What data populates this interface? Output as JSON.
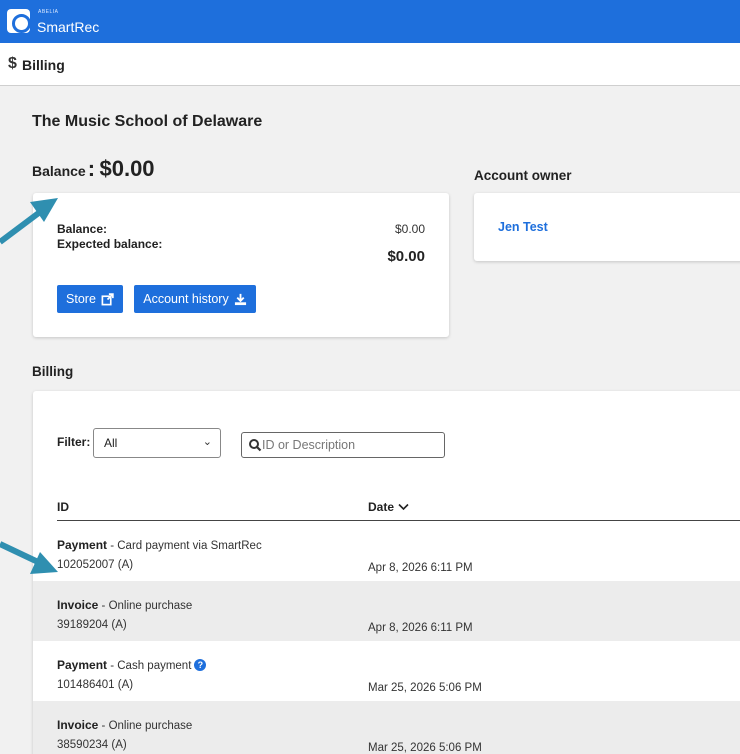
{
  "app": {
    "brand_small": "ABELIA",
    "brand_name": "SmartRec"
  },
  "page": {
    "icon": "$",
    "title": "Billing"
  },
  "organization": "The Music School of Delaware",
  "balance_heading": {
    "label": "Balance",
    "colon": ":",
    "amount": "$0.00"
  },
  "balance_card": {
    "balance_label": "Balance:",
    "balance_value": "$0.00",
    "expected_label": "Expected balance:",
    "expected_value": "$0.00",
    "store_button": "Store",
    "history_button": "Account history"
  },
  "owner": {
    "title": "Account owner",
    "name": "Jen Test"
  },
  "billing": {
    "title": "Billing",
    "filter_label": "Filter:",
    "filter_value": "All",
    "search_placeholder": "ID or Description",
    "columns": {
      "id": "ID",
      "date": "Date"
    },
    "rows": [
      {
        "type": "Payment",
        "description": " - Card payment via SmartRec",
        "id": "102052007 (A)",
        "date": "Apr 8, 2026 6:11 PM"
      },
      {
        "type": "Invoice",
        "description": " - Online purchase",
        "id": "39189204 (A)",
        "date": "Apr 8, 2026 6:11 PM"
      },
      {
        "type": "Payment",
        "description": " - Cash payment",
        "id": "101486401 (A)",
        "date": "Mar 25, 2026 5:06 PM",
        "help": "?"
      },
      {
        "type": "Invoice",
        "description": " - Online purchase",
        "id": "38590234 (A)",
        "date": "Mar 25, 2026 5:06 PM"
      }
    ]
  },
  "colors": {
    "brand_blue": "#1e6fdc",
    "annotation_arrow": "#2f8fb0"
  }
}
